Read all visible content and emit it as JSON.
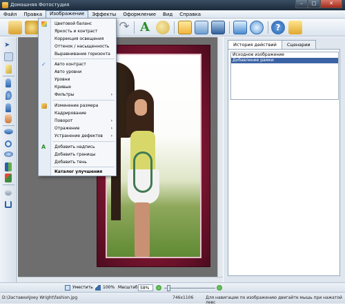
{
  "window": {
    "title": "Домашняя Фотостудия",
    "buttons": [
      "–",
      "□",
      "✕"
    ]
  },
  "menubar": {
    "items": [
      {
        "label": "Файл"
      },
      {
        "label": "Правка"
      },
      {
        "label": "Изображение",
        "active": true
      },
      {
        "label": "Эффекты"
      },
      {
        "label": "Оформление"
      },
      {
        "label": "Вид"
      },
      {
        "label": "Справка"
      }
    ]
  },
  "image_menu": {
    "items": [
      {
        "label": "Цветовой баланс",
        "icon": "color-balance-icon"
      },
      {
        "label": "Яркость и контраст"
      },
      {
        "label": "Коррекция освещения"
      },
      {
        "label": "Оттенок / насыщенность"
      },
      {
        "label": "Выравнивание горизонта"
      },
      {
        "label": "Авто контраст",
        "icon": "checkmark-icon"
      },
      {
        "label": "Авто уровни"
      },
      {
        "label": "Уровни"
      },
      {
        "label": "Кривые"
      },
      {
        "label": "Фильтры",
        "submenu": true
      },
      {
        "label": "Изменение размера",
        "icon": "resize-icon"
      },
      {
        "label": "Кадрирование"
      },
      {
        "label": "Поворот",
        "submenu": true
      },
      {
        "label": "Отражение",
        "submenu": true
      },
      {
        "label": "Устранение дефектов",
        "submenu": true
      },
      {
        "label": "Добавить надпись",
        "icon": "text-icon"
      },
      {
        "label": "Добавить границы"
      },
      {
        "label": "Добавить тень"
      },
      {
        "label": "Каталог улучшения",
        "bold": true
      }
    ],
    "submenu_arrow": "›"
  },
  "right_panel": {
    "tabs": [
      "История действий",
      "Сценарии"
    ],
    "history": [
      "Исходное изображение",
      "Добавление рамки"
    ],
    "selected_index": 1
  },
  "zoombar": {
    "fit_label": "Уместить",
    "hundred_label": "100%",
    "scale_label": "Масштаб:",
    "scale_value": "58%"
  },
  "statusbar": {
    "path": "D:\\Заставки\\Joey Wright\\fashion.jpg",
    "dimensions": "746x1106",
    "hint": "Для навигации по изображению двигайте мышь при нажатой левс"
  },
  "colors": {
    "accent": "#3b63a4",
    "frame": "#7a1530"
  }
}
